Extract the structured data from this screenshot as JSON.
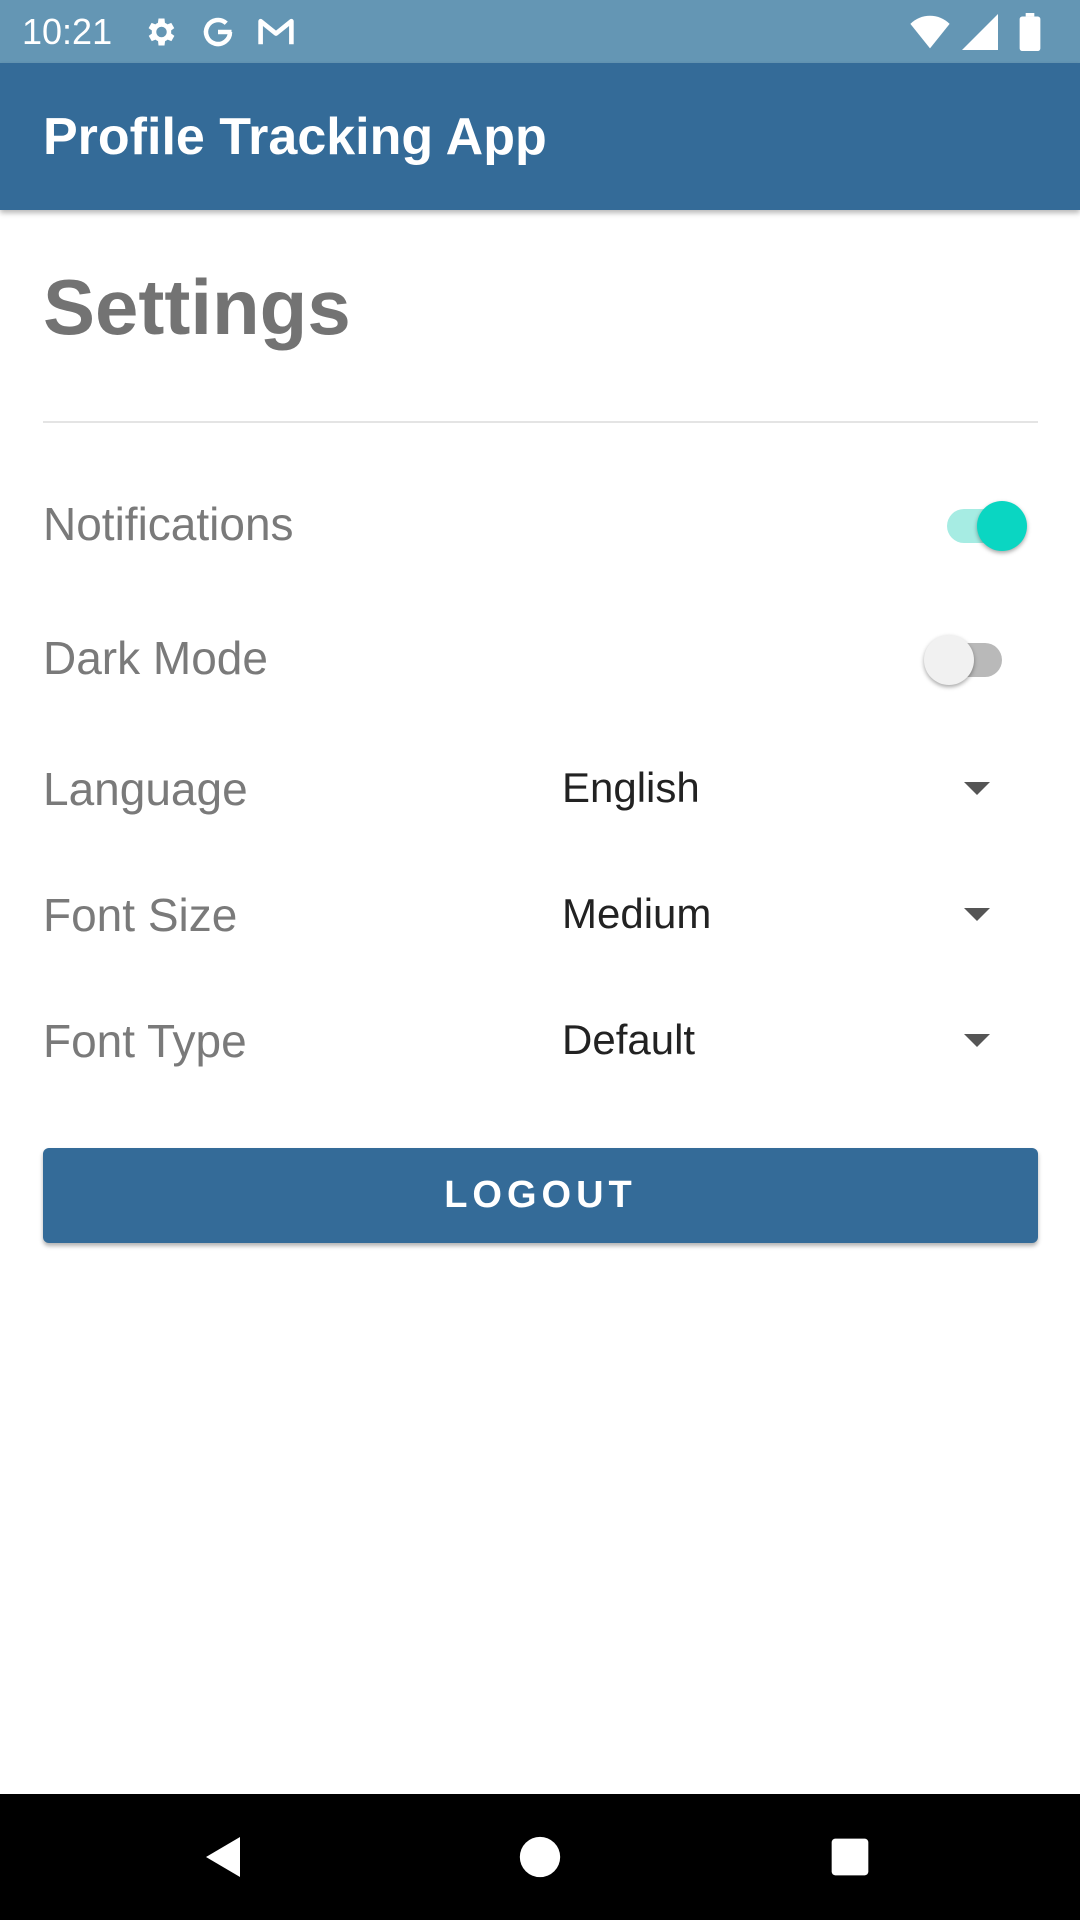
{
  "status_bar": {
    "time": "10:21",
    "icons": [
      "gear-icon",
      "google-g-icon",
      "gmail-icon",
      "wifi-icon",
      "signal-icon",
      "battery-icon"
    ]
  },
  "app_bar": {
    "title": "Profile Tracking App",
    "color": "#346b98"
  },
  "page": {
    "title": "Settings"
  },
  "settings": {
    "notifications": {
      "label": "Notifications",
      "enabled": true
    },
    "dark_mode": {
      "label": "Dark Mode",
      "enabled": false
    },
    "language": {
      "label": "Language",
      "value": "English"
    },
    "font_size": {
      "label": "Font Size",
      "value": "Medium"
    },
    "font_type": {
      "label": "Font Type",
      "value": "Default"
    }
  },
  "logout_button": {
    "label": "LOGOUT"
  },
  "colors": {
    "accent": "#0ad6c2",
    "primary": "#346b98",
    "status_bar": "#6496b4"
  },
  "nav_bar": {
    "icons": [
      "back-icon",
      "home-icon",
      "recents-icon"
    ]
  }
}
